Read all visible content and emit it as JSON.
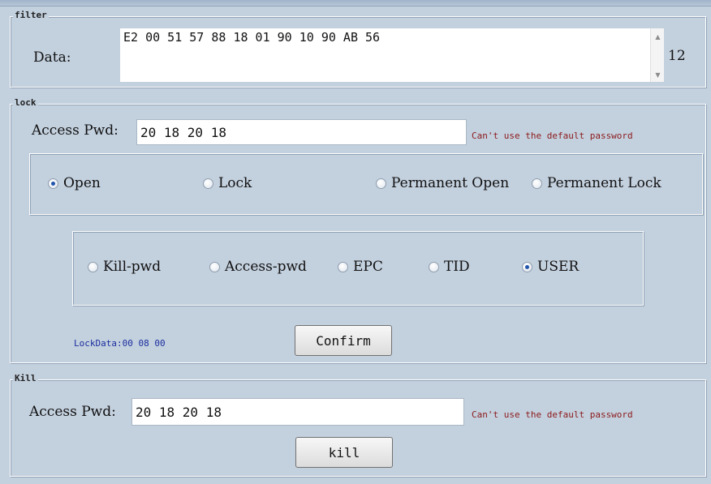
{
  "filter": {
    "title": "filter",
    "data_label": "Data:",
    "data_value": "E2 00 51 57 88 18 01 90 10 90 AB 56",
    "count": "12",
    "scroll_up_icon": "up-arrow",
    "scroll_down_icon": "down-arrow"
  },
  "lock": {
    "title": "lock",
    "access_pwd_label": "Access Pwd:",
    "access_pwd_value": "20 18 20 18",
    "warning": "Can't use the default password",
    "mode_options": [
      {
        "label": "Open",
        "checked": true
      },
      {
        "label": "Lock",
        "checked": false
      },
      {
        "label": "Permanent Open",
        "checked": false
      },
      {
        "label": "Permanent Lock",
        "checked": false
      }
    ],
    "area_options": [
      {
        "label": "Kill-pwd",
        "checked": false
      },
      {
        "label": "Access-pwd",
        "checked": false
      },
      {
        "label": "EPC",
        "checked": false
      },
      {
        "label": "TID",
        "checked": false
      },
      {
        "label": "USER",
        "checked": true
      }
    ],
    "lock_data": "LockData:00 08 00",
    "confirm_label": "Confirm"
  },
  "kill": {
    "title": "Kill",
    "access_pwd_label": "Access Pwd:",
    "access_pwd_value": "20 18 20 18",
    "warning": "Can't use the default password",
    "kill_label": "kill"
  },
  "colors": {
    "background": "#c3d0de",
    "warning": "#8b1a1a",
    "lock_data": "#1a2e9e",
    "radio_checked": "#2255aa"
  }
}
